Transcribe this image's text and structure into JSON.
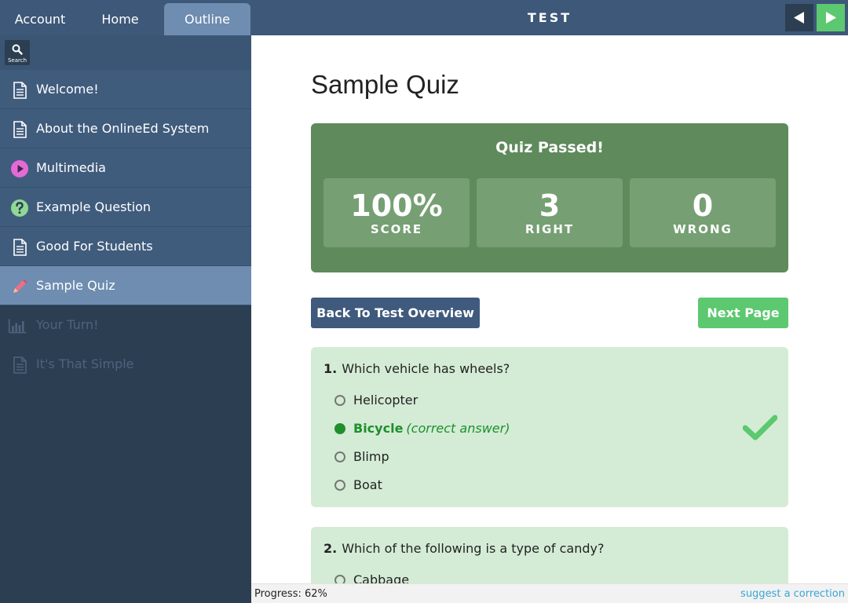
{
  "tabs": {
    "account": "Account",
    "home": "Home",
    "outline": "Outline"
  },
  "search": {
    "label": "Search"
  },
  "sidebar": {
    "items": [
      {
        "label": "Welcome!",
        "icon": "document-icon"
      },
      {
        "label": "About the OnlineEd System",
        "icon": "document-icon"
      },
      {
        "label": "Multimedia",
        "icon": "play-icon"
      },
      {
        "label": "Example Question",
        "icon": "question-icon"
      },
      {
        "label": "Good For Students",
        "icon": "document-icon"
      },
      {
        "label": "Sample Quiz",
        "icon": "pencil-icon"
      },
      {
        "label": "Your Turn!",
        "icon": "chart-icon"
      },
      {
        "label": "It's That Simple",
        "icon": "document-icon"
      }
    ]
  },
  "header": {
    "title": "TEST"
  },
  "page": {
    "title": "Sample Quiz"
  },
  "result": {
    "title": "Quiz Passed!",
    "score_value": "100%",
    "score_label": "SCORE",
    "right_value": "3",
    "right_label": "RIGHT",
    "wrong_value": "0",
    "wrong_label": "WRONG"
  },
  "buttons": {
    "back": "Back To Test Overview",
    "next_page": "Next Page"
  },
  "questions": [
    {
      "number": "1.",
      "text": "Which vehicle has wheels?",
      "options": [
        "Helicopter",
        "Bicycle",
        "Blimp",
        "Boat"
      ],
      "correct_note": "(correct answer)"
    },
    {
      "number": "2.",
      "text": "Which of the following is a type of candy?",
      "options": [
        "Cabbage"
      ]
    }
  ],
  "footer": {
    "progress": "Progress: 62%",
    "suggest": "suggest a correction"
  },
  "colors": {
    "accent_green": "#5cc86f",
    "passed_green": "#5e8a5c",
    "sidebar": "#2c3e52",
    "header": "#3d5878",
    "correct": "#1e8f2c"
  }
}
